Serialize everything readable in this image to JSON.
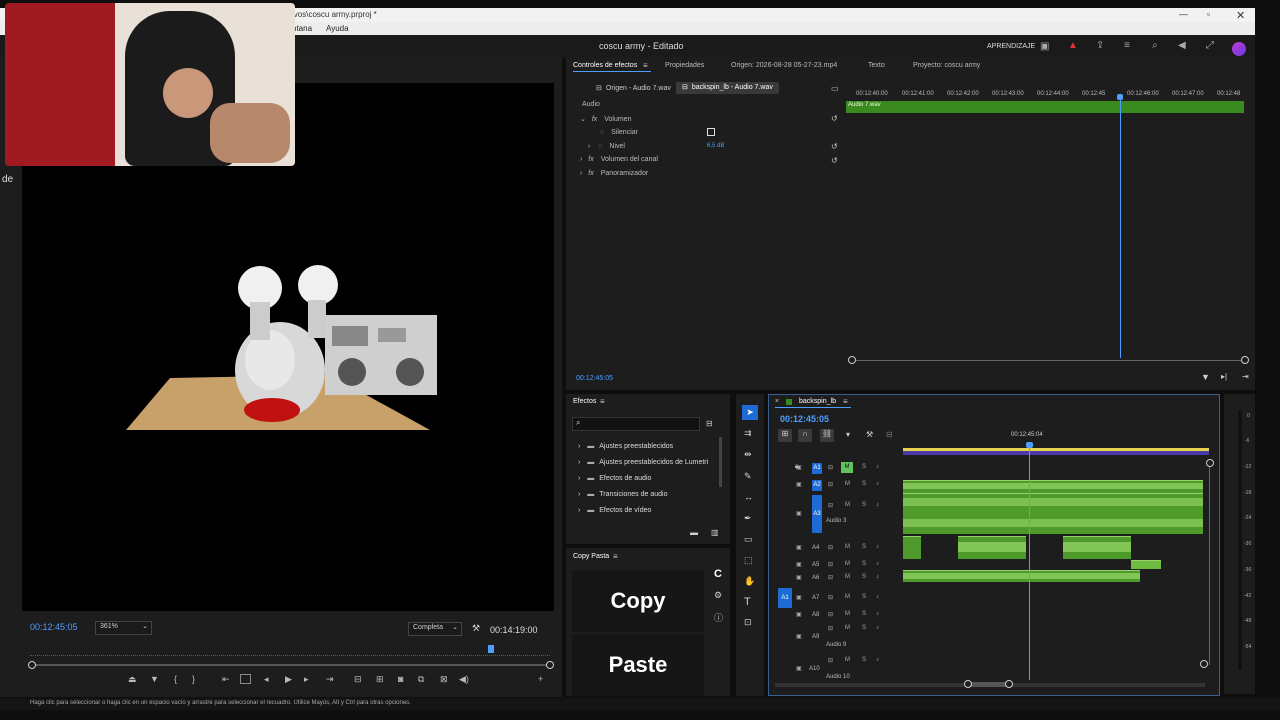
{
  "window": {
    "filepath": "ivos\\coscu army.prproj *",
    "menu": [
      "ntana",
      "Ayuda"
    ],
    "app_title": "coscu army - Editado",
    "learning": "APRENDIZAJE"
  },
  "program_monitor": {
    "left_text": "de",
    "timecode": "00:12:45:05",
    "zoom": "361%",
    "quality": "Completa",
    "duration": "00:14:19:00"
  },
  "effect_controls": {
    "tabs": [
      "Controles de efectos",
      "Propiedades",
      "Origen: 2026-08-28 05-27-23.mp4",
      "Texto",
      "Proyecto: coscu army"
    ],
    "source_chip": "Origen - Audio 7.wav",
    "seq_chip": "backspin_lb - Audio 7.wav",
    "section": "Audio",
    "rows": [
      {
        "label": "Volumen"
      },
      {
        "label": "Silenciar"
      },
      {
        "label": "Nivel",
        "value": "6,5 dB"
      },
      {
        "label": "Volumen del canal"
      },
      {
        "label": "Panoramizador"
      }
    ],
    "ruler": [
      "00:12:40:00",
      "00:12:41:00",
      "00:12:42:00",
      "00:12:43:00",
      "00:12:44:00",
      "00:12:45",
      "00:12:46:00",
      "00:12:47:00",
      "00:12:48"
    ],
    "clip_name": "Audio 7.wav",
    "timecode": "00:12:45:05"
  },
  "effects_panel": {
    "title": "Efectos",
    "items": [
      "Ajustes preestablecidos",
      "Ajustes preestablecidos de Lumetri",
      "Efectos de audio",
      "Transiciones de audio",
      "Efectos de vídeo"
    ]
  },
  "copy_paste": {
    "title": "Copy Pasta",
    "copy": "Copy",
    "paste": "Paste",
    "logo": "C"
  },
  "timeline": {
    "sequence": "backspin_lb",
    "timecode": "00:12:45:05",
    "ruler_time": "00:12:45:04",
    "tracks": [
      {
        "id": "A1",
        "name": ""
      },
      {
        "id": "A2",
        "name": ""
      },
      {
        "id": "A3",
        "name": "Audio 3"
      },
      {
        "id": "A4",
        "name": ""
      },
      {
        "id": "A5",
        "name": ""
      },
      {
        "id": "A6",
        "name": ""
      },
      {
        "id": "A7",
        "name": ""
      },
      {
        "id": "A8",
        "name": ""
      },
      {
        "id": "A9",
        "name": "Audio 9"
      },
      {
        "id": "A10",
        "name": "Audio 10"
      }
    ],
    "source_patch": "A1",
    "meter_scale": [
      "0",
      "-6",
      "-12",
      "-18",
      "-24",
      "-30",
      "-36",
      "-42",
      "-48",
      "-54"
    ]
  },
  "status_bar": "Haga clic para seleccionar o haga clic en un espacio vacío y arrastre para seleccionar el recuadro. Utilice Mayús, Alt y Ctrl para otras opciones."
}
